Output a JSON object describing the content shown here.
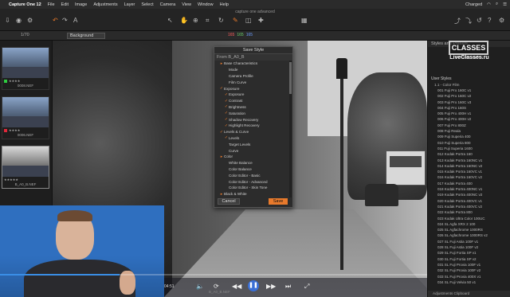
{
  "menubar": {
    "app_name": "Capture One 12",
    "items": [
      "File",
      "Edit",
      "Image",
      "Adjustments",
      "Layer",
      "Select",
      "Camera",
      "View",
      "Window",
      "Help"
    ],
    "battery": "Charged"
  },
  "toolbar": {
    "window_title": "capture one advanced"
  },
  "subbar": {
    "count": "1/70",
    "variant": "Background",
    "rgb": [
      "165",
      "165",
      "165"
    ]
  },
  "browser": {
    "thumbs": [
      {
        "name": "0008.NEF",
        "stars": "★★★★"
      },
      {
        "name": "0006.NEF",
        "stars": "★★★★"
      },
      {
        "name": "B_A0_B.NEF",
        "stars": "★★★★★"
      }
    ]
  },
  "dialog": {
    "title": "Save Style",
    "from": "From B_A0_B",
    "items": [
      {
        "label": "Base Characteristics",
        "checked": false,
        "indent": 1
      },
      {
        "label": "Mode",
        "checked": false,
        "indent": 2
      },
      {
        "label": "Camera Profile",
        "checked": false,
        "indent": 2
      },
      {
        "label": "Film Curve",
        "checked": false,
        "indent": 2
      },
      {
        "label": "Exposure",
        "checked": true,
        "indent": 1
      },
      {
        "label": "Exposure",
        "checked": true,
        "indent": 2
      },
      {
        "label": "Contrast",
        "checked": true,
        "indent": 2
      },
      {
        "label": "Brightness",
        "checked": true,
        "indent": 2
      },
      {
        "label": "Saturation",
        "checked": true,
        "indent": 2
      },
      {
        "label": "Shadow Recovery",
        "checked": true,
        "indent": 2
      },
      {
        "label": "Highlight Recovery",
        "checked": true,
        "indent": 2
      },
      {
        "label": "Levels & Curve",
        "checked": true,
        "indent": 1
      },
      {
        "label": "Levels",
        "checked": true,
        "indent": 2
      },
      {
        "label": "Target Levels",
        "checked": false,
        "indent": 2
      },
      {
        "label": "Curve",
        "checked": false,
        "indent": 2
      },
      {
        "label": "Color",
        "checked": false,
        "indent": 1
      },
      {
        "label": "White Balance",
        "checked": false,
        "indent": 2
      },
      {
        "label": "Color Balance",
        "checked": false,
        "indent": 2
      },
      {
        "label": "Color Editor - Basic",
        "checked": false,
        "indent": 2
      },
      {
        "label": "Color Editor - Advanced",
        "checked": false,
        "indent": 2
      },
      {
        "label": "Color Editor - Skin Tone",
        "checked": false,
        "indent": 2
      },
      {
        "label": "Black & White",
        "checked": false,
        "indent": 1
      },
      {
        "label": "Enabled",
        "checked": false,
        "indent": 2
      }
    ],
    "cancel": "Cancel",
    "save": "Save"
  },
  "rpanel": {
    "header": "Styles and Presets",
    "nostyles": "No styles applied",
    "watermark_top": "CLASSES",
    "watermark_url": "LiveClasses.ru",
    "user_styles": "User Styles",
    "group": "1.1 - Color Film",
    "styles": [
      "001 Fuji Pro 160C v1",
      "002 Fuji Pro 160C v2",
      "003 Fuji Pro 160C v3",
      "004 Fuji Pro 160S",
      "005 Fuji Pro 400H v1",
      "006 Fuji Pro 400H v2",
      "007 Fuji Pro 800Z",
      "008 Fuji Reala",
      "009 Fuji Superia 400",
      "010 Fuji Superia 800",
      "011 Fuji Superia 1600",
      "012 Kodak Portra 160",
      "013 Kodak Portra 160NC v1",
      "014 Kodak Portra 160NC v2",
      "015 Kodak Portra 160VC v1",
      "016 Kodak Portra 160VC v2",
      "017 Kodak Portra 400",
      "018 Kodak Portra 400NC v1",
      "019 Kodak Portra 400NC v2",
      "020 Kodak Portra 400VC v1",
      "021 Kodak Portra 400VC v2",
      "022 Kodak Portra 800",
      "023 Kodak Ultra Color 100UC",
      "024 SL Agfa XRX 2 100",
      "025 SL Agfachrome 1000RS",
      "026 SL Agfachrome 1000RS v2",
      "027 SL Fuji Astia 100F v1",
      "028 SL Fuji Astia 100F v2",
      "029 SL Fuji Fortia SP v1",
      "030 SL Fuji Fortia SP v2",
      "031 SL Fuji Provia 100F v1",
      "032 SL Fuji Provia 100F v2",
      "033 SL Fuji Provia 400X v1",
      "034 SL Fuji Velvia 50 v1"
    ],
    "footer": "Adjustments Clipboard"
  },
  "player": {
    "time": "04:51",
    "filename": "B_A0_B.NEF",
    "progress": 0.28
  },
  "colors": {
    "accent": "#e87a2c",
    "player_blue": "#3a6fd6"
  }
}
